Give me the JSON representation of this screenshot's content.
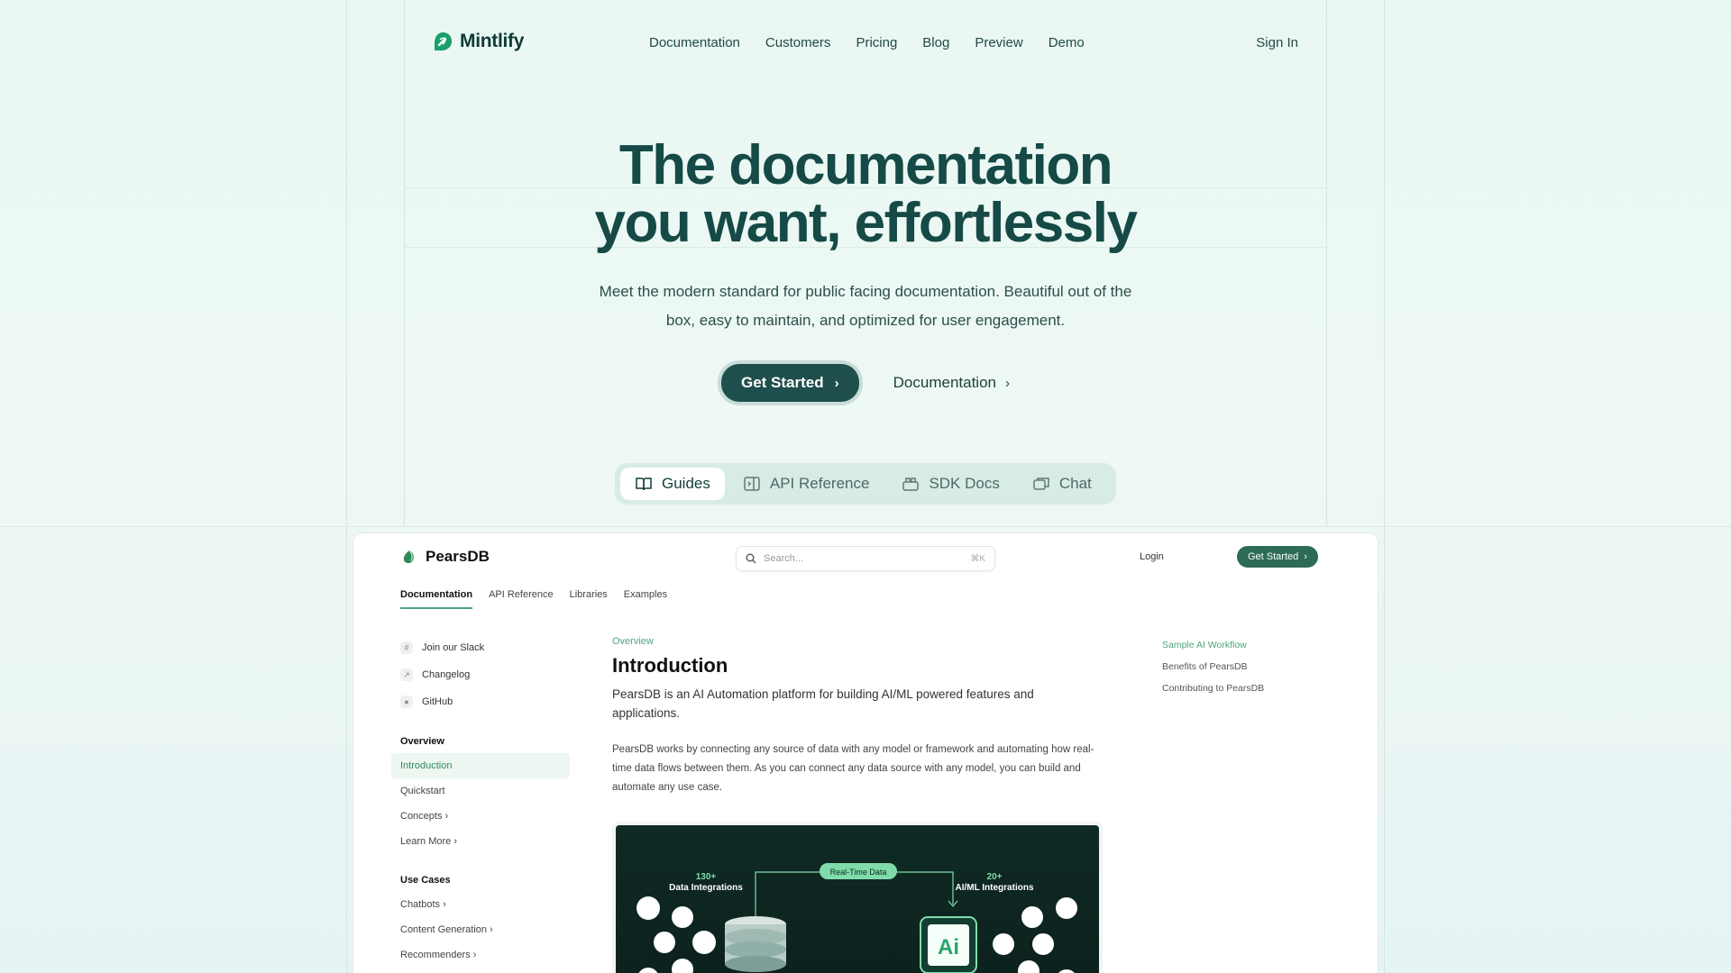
{
  "nav": {
    "brand": "Mintlify",
    "links": [
      "Documentation",
      "Customers",
      "Pricing",
      "Blog",
      "Preview",
      "Demo"
    ],
    "signin": "Sign In"
  },
  "hero": {
    "title_line1": "The documentation",
    "title_line2": "you want, effortlessly",
    "subtitle": "Meet the modern standard for public facing documentation. Beautiful out of the box, easy to maintain, and optimized for user engagement.",
    "primary_cta": "Get Started",
    "secondary_cta": "Documentation"
  },
  "tabs": [
    {
      "label": "Guides",
      "icon": "book-icon",
      "active": true
    },
    {
      "label": "API Reference",
      "icon": "code-panel-icon",
      "active": false
    },
    {
      "label": "SDK Docs",
      "icon": "package-icon",
      "active": false
    },
    {
      "label": "Chat",
      "icon": "chat-icon",
      "active": false
    }
  ],
  "preview": {
    "brand": "PearsDB",
    "search_placeholder": "Search...",
    "search_shortcut": "⌘K",
    "login": "Login",
    "get_started": "Get Started",
    "tabs": [
      "Documentation",
      "API Reference",
      "Libraries",
      "Examples"
    ],
    "side_links": [
      "Join our Slack",
      "Changelog",
      "GitHub"
    ],
    "overview_heading": "Overview",
    "overview_items": [
      "Introduction",
      "Quickstart",
      "Concepts",
      "Learn More"
    ],
    "usecases_heading": "Use Cases",
    "usecase_items": [
      "Chatbots",
      "Content Generation",
      "Recommenders"
    ],
    "eyebrow": "Overview",
    "h1": "Introduction",
    "lead": "PearsDB is an AI Automation platform for building AI/ML powered features and applications.",
    "body": "PearsDB works by connecting any source of data with any model or framework and automating how real-time data flows between them. As you can connect any data source with any model, you can build and automate any use case.",
    "figure": {
      "left_label_count": "130+",
      "left_label": "Data Integrations",
      "center_label": "Real-Time Data",
      "right_label_count": "20+",
      "right_label": "AI/ML Integrations",
      "ai_badge": "Ai"
    },
    "toc": [
      "Sample AI Workflow",
      "Benefits of PearsDB",
      "Contributing to PearsDB"
    ]
  },
  "colors": {
    "brand_dark": "#1e4f4c",
    "accent_green": "#4ea57c",
    "background": "#e9f7f2"
  }
}
